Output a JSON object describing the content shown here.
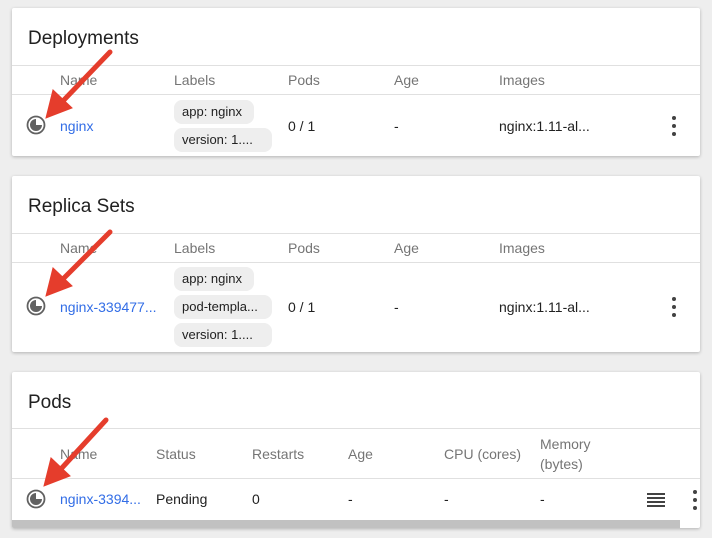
{
  "deployments": {
    "title": "Deployments",
    "columns": {
      "name": "Name",
      "labels": "Labels",
      "pods": "Pods",
      "age": "Age",
      "images": "Images"
    },
    "row": {
      "name": "nginx",
      "labels": [
        "app: nginx",
        "version: 1...."
      ],
      "pods": "0 / 1",
      "age": "-",
      "images": "nginx:1.11-al..."
    }
  },
  "replica_sets": {
    "title": "Replica Sets",
    "columns": {
      "name": "Name",
      "labels": "Labels",
      "pods": "Pods",
      "age": "Age",
      "images": "Images"
    },
    "row": {
      "name": "nginx-339477...",
      "labels": [
        "app: nginx",
        "pod-templa...",
        "version: 1...."
      ],
      "pods": "0 / 1",
      "age": "-",
      "images": "nginx:1.11-al..."
    }
  },
  "pods": {
    "title": "Pods",
    "columns": {
      "name": "Name",
      "status": "Status",
      "restarts": "Restarts",
      "age": "Age",
      "cpu": "CPU (cores)",
      "memory_line1": "Memory",
      "memory_line2": "(bytes)"
    },
    "row": {
      "name": "nginx-3394...",
      "status": "Pending",
      "restarts": "0",
      "age": "-",
      "cpu": "-",
      "memory": "-"
    }
  },
  "icons": {
    "status": "pending-status-icon",
    "menu": "more-vert-icon",
    "logs": "logs-icon",
    "annotation": "red-arrow-annotation"
  },
  "colors": {
    "link": "#326de6",
    "arrow": "#e53d2c",
    "chip": "#eeeeee"
  }
}
